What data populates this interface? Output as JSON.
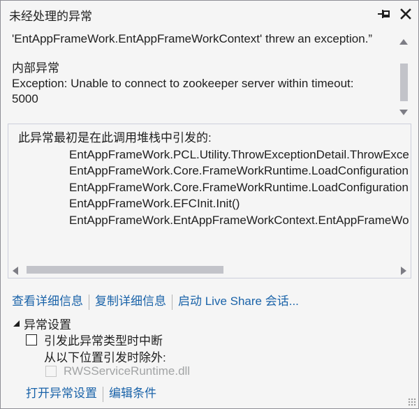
{
  "window": {
    "title": "未经处理的异常",
    "pin_icon": "pin-icon",
    "close_icon": "close-icon"
  },
  "message": {
    "line1": "'EntAppFrameWork.EntAppFrameWorkContext' threw an exception.”",
    "inner_label": "内部异常",
    "inner_text": "Exception: Unable to connect to zookeeper server within timeout: 5000"
  },
  "stack": {
    "header": "此异常最初是在此调用堆栈中引发的:",
    "frames": [
      "EntAppFrameWork.PCL.Utility.ThrowExceptionDetail.ThrowException",
      "EntAppFrameWork.Core.FrameWorkRuntime.LoadConfiguration",
      "EntAppFrameWork.Core.FrameWorkRuntime.LoadConfiguration",
      "EntAppFrameWork.EFCInit.Init()",
      "EntAppFrameWork.EntAppFrameWorkContext.EntAppFrameWorkContext"
    ]
  },
  "links": {
    "view_details": "查看详细信息",
    "copy_details": "复制详细信息",
    "live_share": "启动 Live Share 会话..."
  },
  "settings": {
    "header": "异常设置",
    "break_label": "引发此异常类型时中断",
    "except_label": "从以下位置引发时除外:",
    "module_label": "RWSServiceRuntime.dll",
    "open_settings": "打开异常设置",
    "edit_conditions": "编辑条件"
  },
  "colors": {
    "link": "#1a63a9",
    "background": "#f5f5f5",
    "border": "#cccedb",
    "disabled_text": "#a2a4a5"
  }
}
